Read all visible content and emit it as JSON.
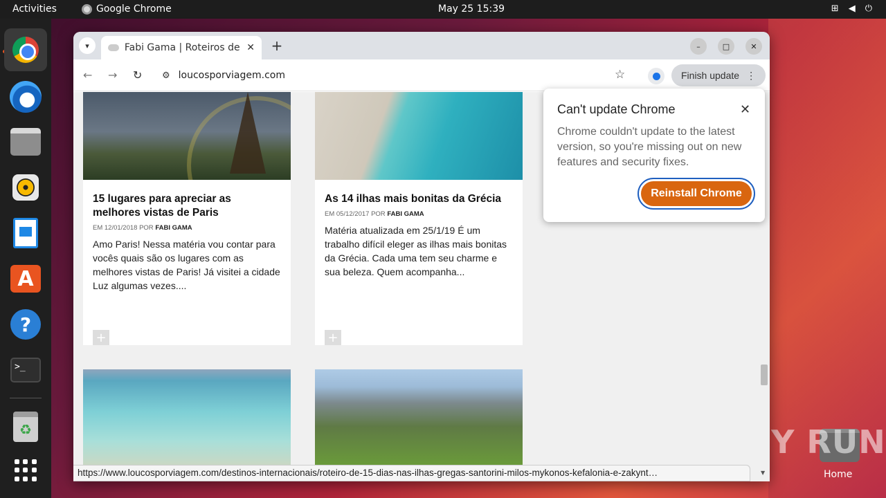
{
  "topbar": {
    "activities": "Activities",
    "app_name": "Google Chrome",
    "clock": "May 25  15:39"
  },
  "browser": {
    "tab_title": "Fabi Gama | Roteiros de V",
    "url": "loucosporviagem.com",
    "finish_update": "Finish update",
    "status_url": "https://www.loucosporviagem.com/destinos-internacionais/roteiro-de-15-dias-nas-ilhas-gregas-santorini-milos-mykonos-kefalonia-e-zakynt…"
  },
  "cards": [
    {
      "title": "15 lugares para apreciar as melhores vistas de Paris",
      "meta_prefix": "EM 12/01/2018 POR",
      "author": "FABI GAMA",
      "excerpt": "Amo Paris! Nessa matéria vou contar para vocês quais são os lugares com as melhores vistas de Paris! Já visitei a cidade Luz algumas vezes...."
    },
    {
      "title": "As 14 ilhas mais bonitas da Grécia",
      "meta_prefix": "EM 05/12/2017 POR",
      "author": "FABI GAMA",
      "excerpt": "Matéria atualizada em 25/1/19 É um trabalho difícil eleger as ilhas mais bonitas da Grécia. Cada uma tem seu charme e sua beleza. Quem acompanha..."
    }
  ],
  "popup": {
    "title": "Can't update Chrome",
    "body": "Chrome couldn't update to the latest version, so you're missing out on new features and security fixes.",
    "button": "Reinstall Chrome"
  },
  "desktop": {
    "home_label": "Home",
    "watermark": "ANY RUN"
  },
  "colors": {
    "accent": "#d9660f",
    "focus_ring": "#1f5fbf",
    "ubuntu_orange": "#e95420"
  }
}
